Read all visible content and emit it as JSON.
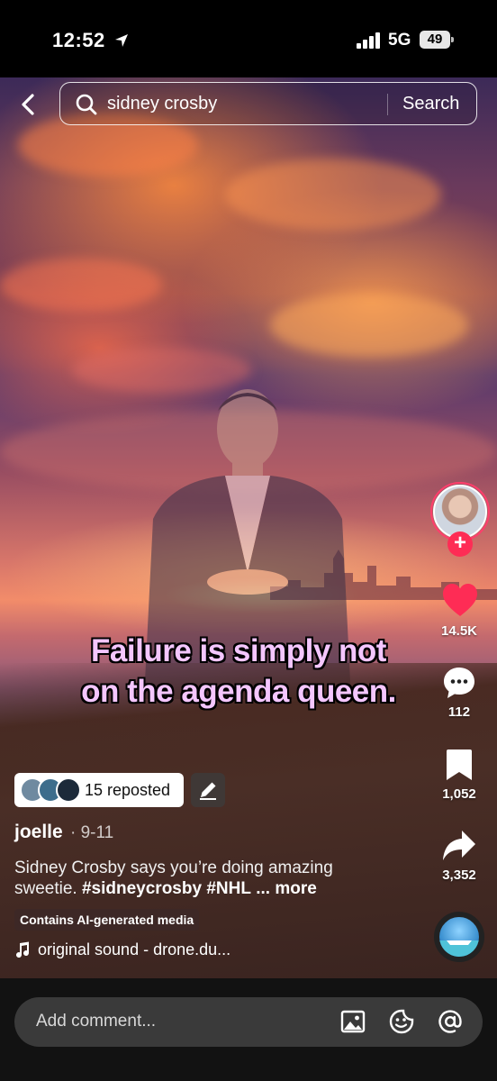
{
  "status_bar": {
    "time": "12:52",
    "network": "5G",
    "battery": "49"
  },
  "search": {
    "query": "sidney crosby",
    "button_label": "Search"
  },
  "video": {
    "caption_lines": [
      "Failure is simply not",
      "on the agenda queen."
    ]
  },
  "actions": {
    "likes": "14.5K",
    "comments": "112",
    "saves": "1,052",
    "shares": "3,352"
  },
  "post": {
    "repost_label": "15 reposted",
    "author": "joelle",
    "date": "· 9-11",
    "description": "Sidney Crosby says you’re doing amazing sweetie.",
    "hashtags": "#sidneycrosby #NHL",
    "more_label": "... more",
    "ai_label": "Contains AI-generated media",
    "sound": "original sound - drone.du..."
  },
  "comment": {
    "placeholder": "Add comment..."
  },
  "colors": {
    "like": "#fe2c55",
    "caption": "#f4c6ff",
    "follow": "#fe2c55"
  }
}
